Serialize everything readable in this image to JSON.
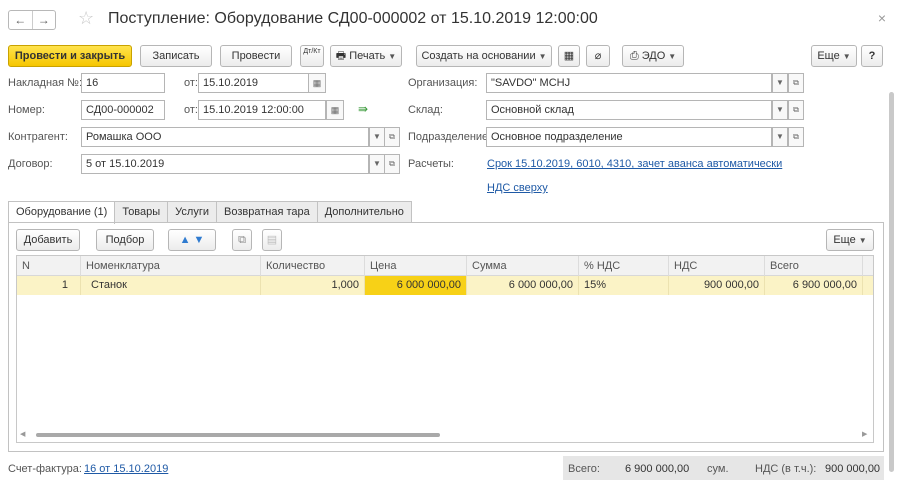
{
  "title": "Поступление: Оборудование СД00-000002 от 15.10.2019 12:00:00",
  "nav": {
    "back": "←",
    "forward": "→"
  },
  "toolbar": {
    "post_close": "Провести и закрыть",
    "save": "Записать",
    "post": "Провести",
    "dtkt": "Дт/Кт",
    "print": "Печать",
    "create_based": "Создать на основании",
    "edo": "ЭДО",
    "more": "Еще",
    "help": "?"
  },
  "form": {
    "invoice_no_label": "Накладная  №:",
    "invoice_no": "16",
    "from_label": "от:",
    "invoice_date": "15.10.2019",
    "number_label": "Номер:",
    "number": "СД00-000002",
    "number_from_label": "от:",
    "number_date": "15.10.2019 12:00:00",
    "contractor_label": "Контрагент:",
    "contractor": "Ромашка ООО",
    "contract_label": "Договор:",
    "contract": "5 от 15.10.2019",
    "org_label": "Организация:",
    "org": "\"SAVDO\" MCHJ",
    "warehouse_label": "Склад:",
    "warehouse": "Основной склад",
    "division_label": "Подразделение:",
    "division": "Основное подразделение",
    "settlements_label": "Расчеты:",
    "settlements_link": "Срок 15.10.2019, 6010, 4310, зачет аванса автоматически",
    "vat_link": "НДС сверху"
  },
  "tabs": [
    "Оборудование (1)",
    "Товары",
    "Услуги",
    "Возвратная тара",
    "Дополнительно"
  ],
  "table_toolbar": {
    "add": "Добавить",
    "select": "Подбор",
    "more": "Еще"
  },
  "table": {
    "headers": [
      "N",
      "Номенклатура",
      "Количество",
      "Цена",
      "Сумма",
      "% НДС",
      "НДС",
      "Всего"
    ],
    "rows": [
      [
        "1",
        "Станок",
        "1,000",
        "6 000 000,00",
        "6 000 000,00",
        "15%",
        "900 000,00",
        "6 900 000,00"
      ]
    ]
  },
  "footer": {
    "invoice_label": "Счет-фактура:",
    "invoice_link": "16 от 15.10.2019",
    "total_label": "Всего:",
    "total": "6 900 000,00",
    "currency": "сум.",
    "vat_label": "НДС (в т.ч.):",
    "vat": "900 000,00"
  },
  "colors": {
    "primary_button": "#f6c600",
    "selected_row": "#fbf3c6",
    "active_cell": "#f7d117",
    "link": "#1f5aa6"
  }
}
